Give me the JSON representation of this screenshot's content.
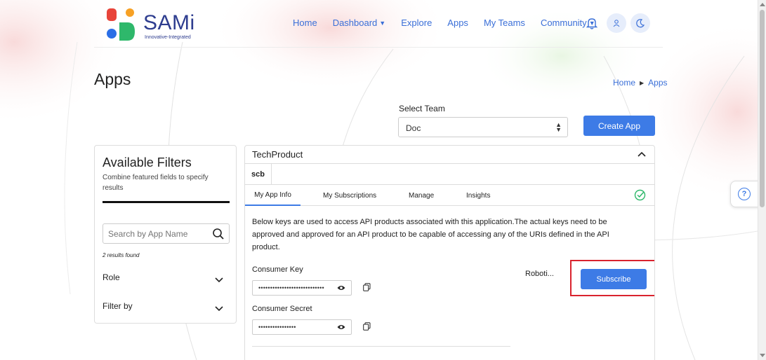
{
  "brand": {
    "name": "SAMi",
    "tagline": "Innovative-Integrated",
    "colors": {
      "primary": "#3d7be6",
      "logo_text": "#2e3d8f",
      "logo_red": "#e8443a",
      "logo_orange": "#f7a125",
      "logo_blue": "#2b6ee6",
      "logo_green": "#2eb86b",
      "highlight": "#d9232e"
    }
  },
  "nav": {
    "items": [
      {
        "label": "Home"
      },
      {
        "label": "Dashboard",
        "dropdown": true
      },
      {
        "label": "Explore"
      },
      {
        "label": "Apps"
      },
      {
        "label": "My Teams"
      },
      {
        "label": "Community",
        "dropdown": true
      }
    ],
    "icons": [
      "bell-icon",
      "user-icon",
      "moon-icon"
    ]
  },
  "page": {
    "title": "Apps",
    "breadcrumb": [
      "Home",
      "Apps"
    ]
  },
  "team": {
    "label": "Select Team",
    "selected": "Doc",
    "create_label": "Create App"
  },
  "filters": {
    "title": "Available Filters",
    "subtitle": "Combine featured fields to specify results",
    "search_placeholder": "Search by App Name",
    "results_text": "2 results found",
    "groups": [
      "Role",
      "Filter by"
    ]
  },
  "app": {
    "name": "TechProduct",
    "sub_label": "scb",
    "tabs": [
      "My App Info",
      "My Subscriptions",
      "Manage",
      "Insights"
    ],
    "active_tab": "My App Info",
    "description": "Below keys are used to access API products associated with this application.The actual keys need to be approved and approved for an API product to be capable of accessing any of the URIs defined in the API product.",
    "consumer_key_label": "Consumer Key",
    "consumer_key_value": "••••••••••••••••••••••••••••",
    "consumer_secret_label": "Consumer Secret",
    "consumer_secret_value": "••••••••••••••••",
    "product_name": "Roboti...",
    "subscribe_label": "Subscribe"
  },
  "help": {
    "label": "?"
  }
}
